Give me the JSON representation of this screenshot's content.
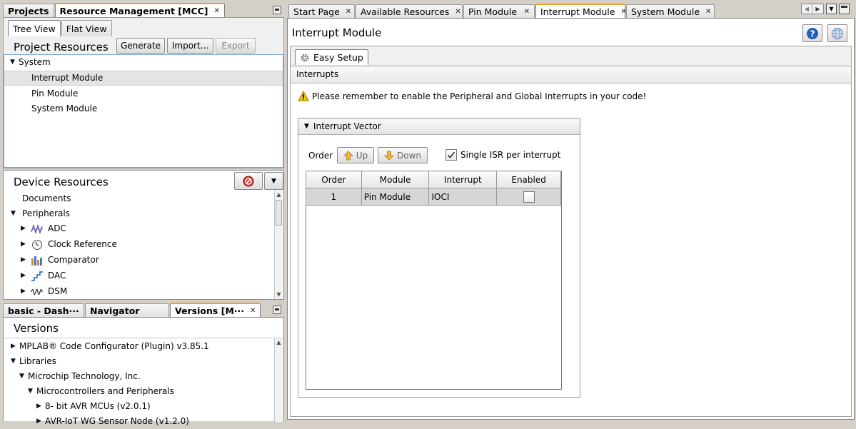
{
  "left_top_tabs": [
    {
      "label": "Projects",
      "closable": false,
      "active": false
    },
    {
      "label": "Resource Management [MCC]",
      "closable": true,
      "active": true
    }
  ],
  "view_tabs": [
    "Tree View",
    "Flat View"
  ],
  "project_resources": {
    "title": "Project Resources",
    "buttons": {
      "generate": "Generate",
      "import": "Import...",
      "export": "Export"
    },
    "tree": [
      {
        "label": "System",
        "level": 0,
        "expanded": true
      },
      {
        "label": "Interrupt Module",
        "level": 1,
        "selected": true
      },
      {
        "label": "Pin Module",
        "level": 1
      },
      {
        "label": "System Module",
        "level": 1
      }
    ]
  },
  "device_resources": {
    "title": "Device Resources",
    "items": [
      {
        "label": "Documents",
        "level": 0,
        "icon": ""
      },
      {
        "label": "Peripherals",
        "level": 0,
        "expanded": true,
        "icon": ""
      },
      {
        "label": "ADC",
        "level": 1,
        "icon": "adc-icon"
      },
      {
        "label": "Clock Reference",
        "level": 1,
        "icon": "clock-icon"
      },
      {
        "label": "Comparator",
        "level": 1,
        "icon": "comparator-icon"
      },
      {
        "label": "DAC",
        "level": 1,
        "icon": "dac-icon"
      },
      {
        "label": "DSM",
        "level": 1,
        "icon": "dsm-icon"
      }
    ]
  },
  "left_bottom_tabs": [
    {
      "label": "basic - Dash···",
      "closable": false,
      "active": false
    },
    {
      "label": "Navigator",
      "closable": false,
      "active": false
    },
    {
      "label": "Versions [M···",
      "closable": true,
      "active": true
    }
  ],
  "versions": {
    "title": "Versions",
    "items": [
      {
        "label": "MPLAB® Code Configurator (Plugin) v3.85.1",
        "level": 0,
        "expanded": false
      },
      {
        "label": "Libraries",
        "level": 0,
        "expanded": true
      },
      {
        "label": "Microchip Technology, Inc.",
        "level": 1,
        "expanded": true
      },
      {
        "label": "Microcontrollers and Peripherals",
        "level": 2,
        "expanded": true
      },
      {
        "label": "8- bit AVR MCUs (v2.0.1)",
        "level": 3,
        "expanded": false
      },
      {
        "label": "AVR-IoT WG Sensor Node (v1.2.0)",
        "level": 3,
        "expanded": false
      }
    ]
  },
  "editor_tabs": [
    {
      "label": "Start Page",
      "active": false
    },
    {
      "label": "Available Resources",
      "active": false
    },
    {
      "label": "Pin Module",
      "active": false
    },
    {
      "label": "Interrupt Module",
      "active": true
    },
    {
      "label": "System Module",
      "active": false
    }
  ],
  "module": {
    "title": "Interrupt Module",
    "easy_setup_tab": "Easy Setup",
    "section_title": "Interrupts",
    "warning": "Please remember to enable the Peripheral and Global Interrupts in your code!",
    "vector": {
      "title": "Interrupt Vector",
      "order_label": "Order",
      "up_label": "Up",
      "down_label": "Down",
      "single_isr_label": "Single ISR per interrupt",
      "single_isr_checked": true,
      "columns": [
        "Order",
        "Module",
        "Interrupt",
        "Enabled"
      ],
      "rows": [
        {
          "order": "1",
          "module": "Pin Module",
          "interrupt": "IOCI",
          "enabled": false
        }
      ]
    }
  },
  "colors": {
    "active_tab_accent": "#f0a030",
    "help_icon": "#1f5fb8",
    "warning_icon": "#f4c20d"
  }
}
